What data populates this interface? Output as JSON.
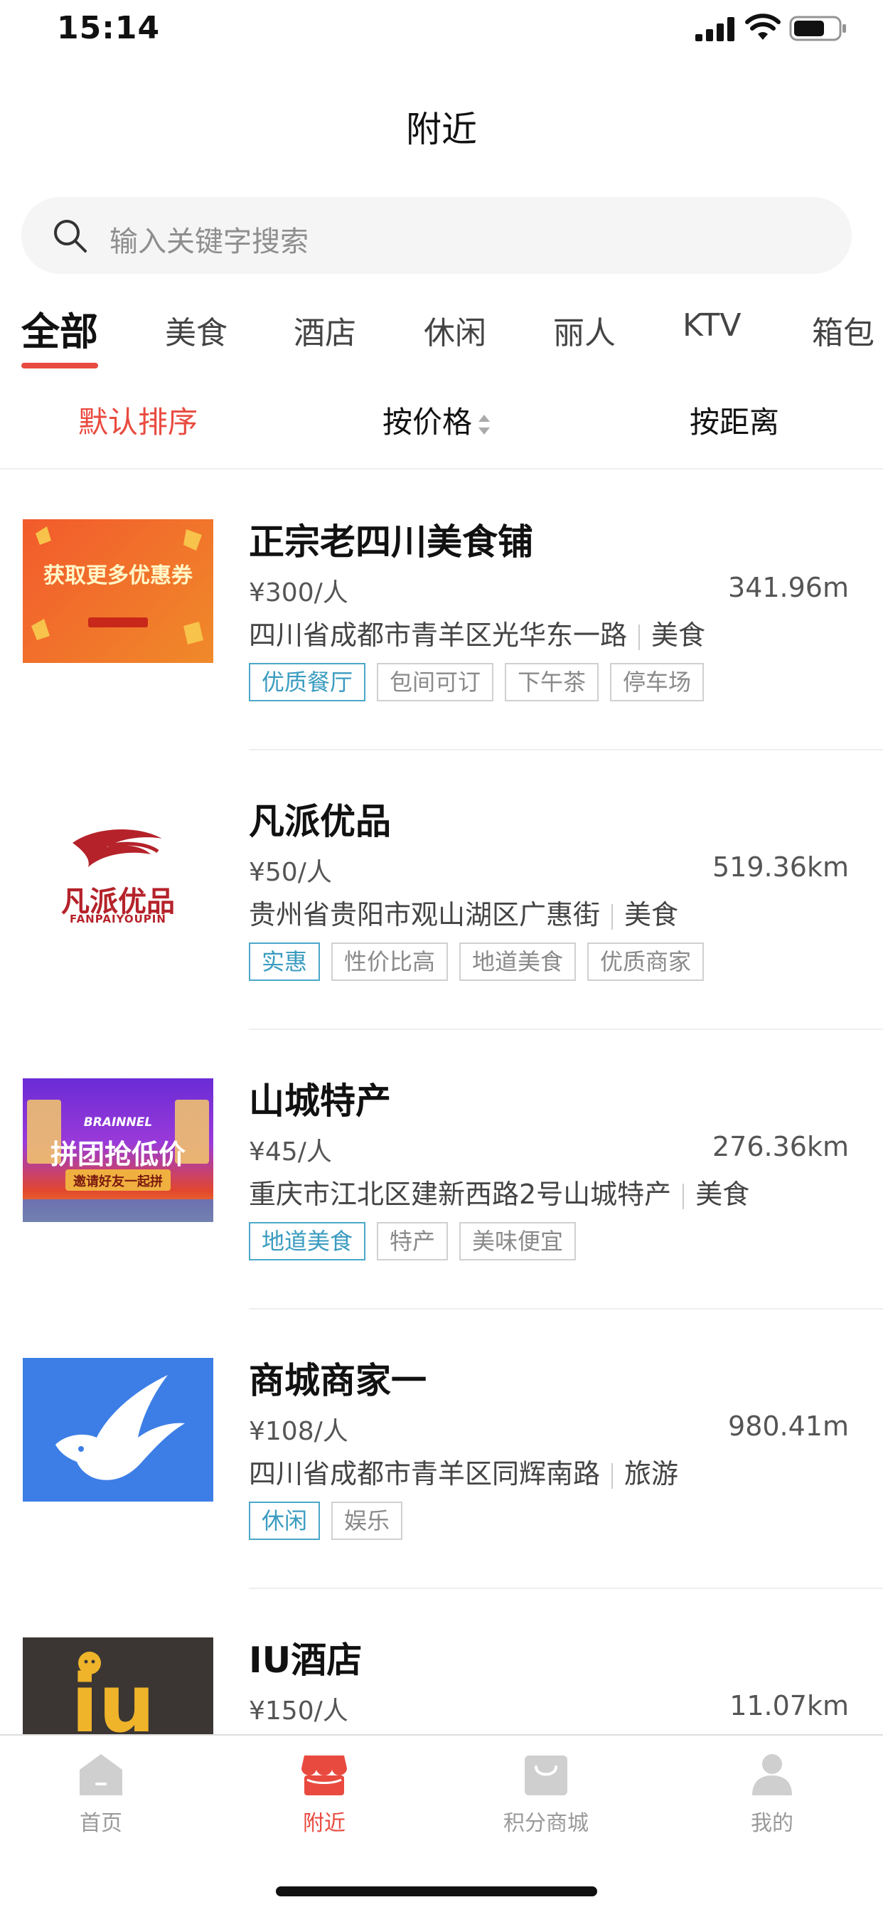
{
  "status_bar": {
    "time": "15:14"
  },
  "page_title": "附近",
  "search": {
    "placeholder": "输入关键字搜索"
  },
  "tabs": [
    "全部",
    "美食",
    "酒店",
    "休闲",
    "丽人",
    "KTV",
    "箱包"
  ],
  "active_tab": "全部",
  "sort": {
    "default_label": "默认排序",
    "price_label": "按价格",
    "distance_label": "按距离"
  },
  "colors": {
    "accent": "#e94a3f",
    "tag_highlight": "#3b9cc0",
    "tag_border": "#d0d0d0"
  },
  "listings": [
    {
      "name": "正宗老四川美食铺",
      "price": "¥300/人",
      "distance": "341.96m",
      "address": "四川省成都市青羊区光华东一路",
      "category": "美食",
      "tags": [
        "优质餐厅",
        "包间可订",
        "下午茶",
        "停车场"
      ],
      "highlight_tag": 0,
      "thumb": {
        "kind": "coupon-banner",
        "text": "获取更多优惠券"
      }
    },
    {
      "name": "凡派优品",
      "price": "¥50/人",
      "distance": "519.36km",
      "address": "贵州省贵阳市观山湖区广惠街",
      "category": "美食",
      "tags": [
        "实惠",
        "性价比高",
        "地道美食",
        "优质商家"
      ],
      "highlight_tag": 0,
      "thumb": {
        "kind": "logo",
        "text": "凡派优品",
        "subtext": "FANPAIYOUPIN"
      }
    },
    {
      "name": "山城特产",
      "price": "¥45/人",
      "distance": "276.36km",
      "address": "重庆市江北区建新西路2号山城特产",
      "category": "美食",
      "tags": [
        "地道美食",
        "特产",
        "美味便宜"
      ],
      "highlight_tag": 0,
      "thumb": {
        "kind": "group-buy-banner",
        "brand": "BRAINNEL",
        "text": "拼团抢低价",
        "subtext": "邀请好友一起拼"
      }
    },
    {
      "name": "商城商家一",
      "price": "¥108/人",
      "distance": "980.41m",
      "address": "四川省成都市青羊区同辉南路",
      "category": "旅游",
      "tags": [
        "休闲",
        "娱乐"
      ],
      "highlight_tag": 0,
      "thumb": {
        "kind": "bird-logo"
      }
    },
    {
      "name": "IU酒店",
      "price": "¥150/人",
      "distance": "11.07km",
      "address": "",
      "category": "",
      "tags": [],
      "highlight_tag": -1,
      "thumb": {
        "kind": "iu-logo",
        "text": "iu"
      }
    }
  ],
  "tabbar": {
    "items": [
      {
        "label": "首页",
        "icon": "home-icon"
      },
      {
        "label": "附近",
        "icon": "nearby-store-icon"
      },
      {
        "label": "积分商城",
        "icon": "shopping-bag-icon"
      },
      {
        "label": "我的",
        "icon": "user-icon"
      }
    ],
    "active": "附近"
  }
}
